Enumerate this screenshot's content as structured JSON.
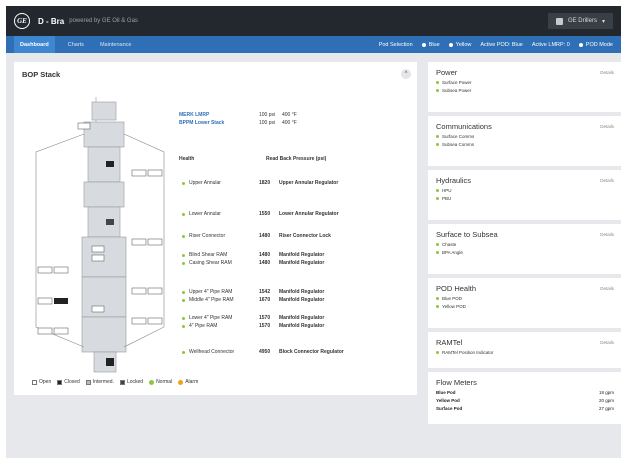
{
  "topbar": {
    "logo_text": "GE",
    "brand": "D - Bra",
    "brand_sub": "powered by GE Oil & Gas",
    "user": "GE Drillers"
  },
  "nav": {
    "tabs": [
      {
        "label": "Dashboard"
      },
      {
        "label": "Charts"
      },
      {
        "label": "Maintenance"
      }
    ],
    "status": [
      {
        "label": "Pod Selection"
      },
      {
        "label": "Blue"
      },
      {
        "label": "Yellow"
      },
      {
        "label": "Active POD: Blue"
      },
      {
        "label": "Active LMRP: 0"
      },
      {
        "label": "POD Mode"
      }
    ]
  },
  "bop": {
    "title": "BOP Stack",
    "collapse_glyph": "^",
    "wellpress": [
      {
        "label": "MERK LMRP",
        "value1": "100 psi",
        "value2": "400 °F"
      },
      {
        "label": "BPPM Lower Stack",
        "value1": "100 psi",
        "value2": "400 °F"
      }
    ],
    "col_health": "Health",
    "col_read": "Read Back Pressure (psi)",
    "components": [
      {
        "name": "Upper Annular",
        "value": "1820",
        "fn": "Upper Annular Regulator"
      },
      {
        "name": "Lower Annular",
        "value": "1550",
        "fn": "Lower Annular Regulator"
      },
      {
        "name": "Riser Connector",
        "value": "1480",
        "fn": "Riser Connector Lock"
      },
      {
        "name": "Blind Shear RAM",
        "value": "1480",
        "fn": "Manifold Regulator"
      },
      {
        "name": "Casing Shear RAM",
        "value": "1480",
        "fn": "Manifold Regulator"
      },
      {
        "name": "Upper 4\" Pipe RAM",
        "value": "1542",
        "fn": "Manifold Regulator"
      },
      {
        "name": "Middle 4\" Pipe RAM",
        "value": "1670",
        "fn": "Manifold Regulator"
      },
      {
        "name": "Lower 4\" Pipe RAM",
        "value": "1570",
        "fn": "Manifold Regulator"
      },
      {
        "name": "4\" Pipe RAM",
        "value": "1570",
        "fn": "Manifold Regulator"
      },
      {
        "name": "Wellhead Connector",
        "value": "4950",
        "fn": "Block Connector Regulator"
      }
    ],
    "legend": [
      {
        "label": "Open",
        "color": "#ffffff"
      },
      {
        "label": "Closed",
        "color": "#222222"
      },
      {
        "label": "Intermed.",
        "color": "#bbbbbb"
      },
      {
        "label": "Locked",
        "color": "#444444"
      },
      {
        "label": "Normal",
        "color": "#8cc63f"
      },
      {
        "label": "Alarm",
        "color": "#f0a020"
      }
    ]
  },
  "sidebar": {
    "details_label": "Details",
    "cards": [
      {
        "title": "Power",
        "items": [
          "Surface Power",
          "Subsea Power"
        ]
      },
      {
        "title": "Communications",
        "items": [
          "Surface Comms",
          "Subsea Comms"
        ]
      },
      {
        "title": "Hydraulics",
        "items": [
          "HPU",
          "PBU"
        ]
      },
      {
        "title": "Surface to Subsea",
        "items": [
          "Chaste",
          "BPA Angle"
        ]
      },
      {
        "title": "POD Health",
        "items": [
          "Blue POD",
          "Yellow POD"
        ]
      },
      {
        "title": "RAMTel",
        "items": [
          "RAMTel Position Indicator"
        ]
      }
    ],
    "flow": {
      "title": "Flow Meters",
      "rows": [
        {
          "label": "Blue Pod",
          "value": "18 gpm"
        },
        {
          "label": "Yellow Pod",
          "value": "20 gpm"
        },
        {
          "label": "Surface Pod",
          "value": "27 gpm"
        }
      ]
    }
  }
}
